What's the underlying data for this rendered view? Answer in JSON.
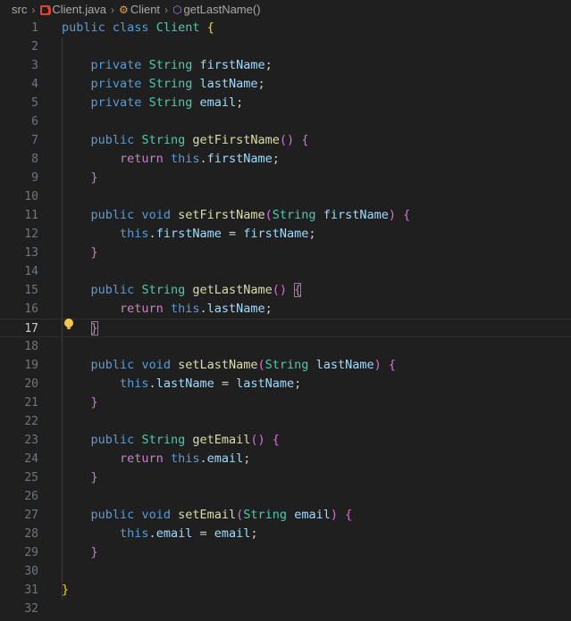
{
  "breadcrumb": {
    "src": "src",
    "file": "Client.java",
    "class": "Client",
    "method": "getLastName()"
  },
  "editor": {
    "line_numbers": [
      "1",
      "2",
      "3",
      "4",
      "5",
      "6",
      "7",
      "8",
      "9",
      "10",
      "11",
      "12",
      "13",
      "14",
      "15",
      "16",
      "17",
      "18",
      "19",
      "20",
      "21",
      "22",
      "23",
      "24",
      "25",
      "26",
      "27",
      "28",
      "29",
      "30",
      "31",
      "32"
    ],
    "active_line": "17"
  }
}
